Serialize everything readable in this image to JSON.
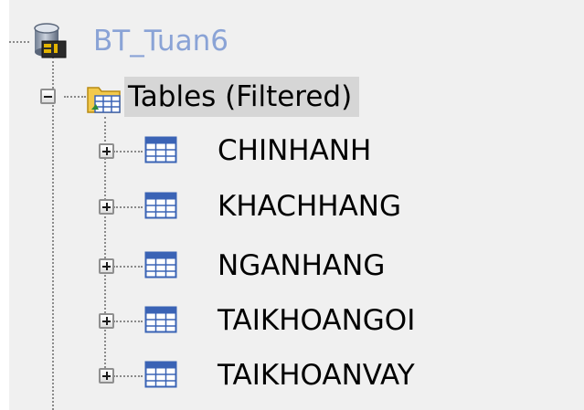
{
  "tree": {
    "database": {
      "label": "BT_Tuan6",
      "icon": "database-icon"
    },
    "folder": {
      "label": "Tables (Filtered)",
      "icon": "table-folder-icon",
      "expanded": true
    },
    "tables": [
      {
        "label": "CHINHANH",
        "icon": "table-icon",
        "expanded": false
      },
      {
        "label": "KHACHHANG",
        "icon": "table-icon",
        "expanded": false
      },
      {
        "label": "NGANHANG",
        "icon": "table-icon",
        "expanded": false
      },
      {
        "label": "TAIKHOANGOI",
        "icon": "table-icon",
        "expanded": false
      },
      {
        "label": "TAIKHOANVAY",
        "icon": "table-icon",
        "expanded": false
      }
    ],
    "colors": {
      "panel_background": "#f0f0f0",
      "database_label": "#8aa3d6",
      "selection": "#d6d6d6",
      "table_icon": "#3a63b5"
    }
  }
}
